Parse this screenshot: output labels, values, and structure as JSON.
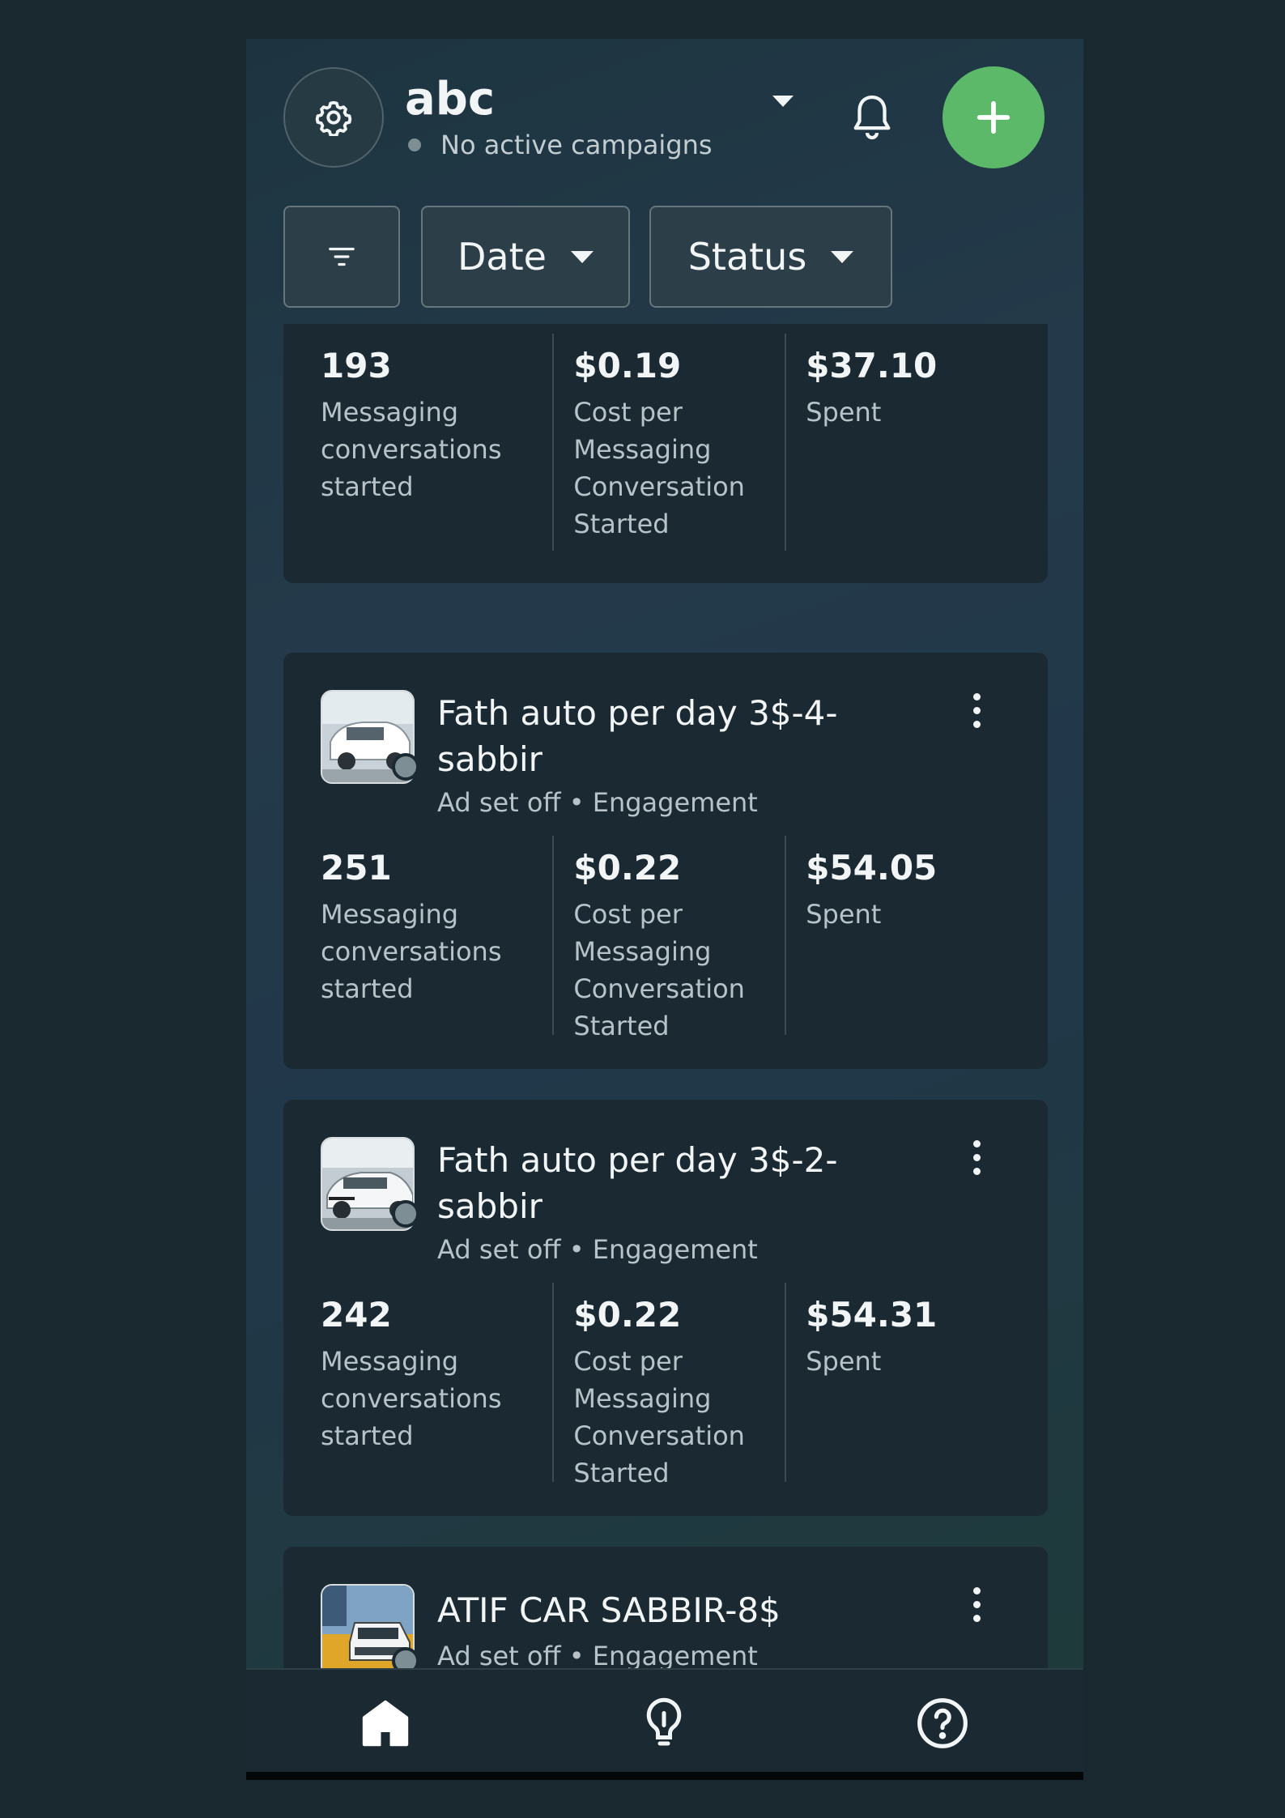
{
  "header": {
    "account_name": "abc",
    "account_status": "No active campaigns"
  },
  "filters": {
    "date_label": "Date",
    "status_label": "Status"
  },
  "cards": [
    {
      "title": "",
      "subtitle": "",
      "metrics": [
        {
          "value": "193",
          "label": "Messaging conversations started"
        },
        {
          "value": "$0.19",
          "label": "Cost per Messaging Conversation Started"
        },
        {
          "value": "$37.10",
          "label": "Spent"
        }
      ]
    },
    {
      "title": "Fath auto per day 3$-4-sabbir",
      "subtitle": "Ad set off • Engagement",
      "metrics": [
        {
          "value": "251",
          "label": "Messaging conversations started"
        },
        {
          "value": "$0.22",
          "label": "Cost per Messaging Conversation Started"
        },
        {
          "value": "$54.05",
          "label": "Spent"
        }
      ]
    },
    {
      "title": "Fath auto per day 3$-2-sabbir",
      "subtitle": "Ad set off • Engagement",
      "metrics": [
        {
          "value": "242",
          "label": "Messaging conversations started"
        },
        {
          "value": "$0.22",
          "label": "Cost per Messaging Conversation Started"
        },
        {
          "value": "$54.31",
          "label": "Spent"
        }
      ]
    },
    {
      "title": "ATIF CAR SABBIR-8$",
      "subtitle": "Ad set off • Engagement",
      "metrics": []
    }
  ],
  "icons": {
    "settings": "gear-icon",
    "notifications": "bell-icon",
    "create": "plus-icon",
    "filter": "filter-icon",
    "home": "home-icon",
    "tips": "lightbulb-icon",
    "help": "question-icon"
  },
  "colors": {
    "accent": "#5cb96a",
    "card_bg": "#1b2a32",
    "status_off": "#7d8e95"
  }
}
